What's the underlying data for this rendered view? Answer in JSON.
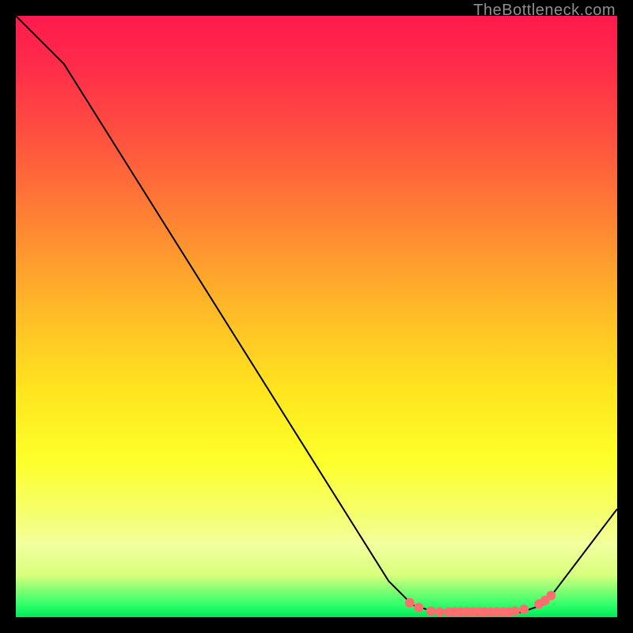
{
  "credit": "TheBottleneck.com",
  "colors": {
    "marker": "#ff6e6e",
    "curve": "#000000"
  },
  "chart_data": {
    "type": "line",
    "title": "",
    "xlabel": "",
    "ylabel": "",
    "xlim": [
      0,
      100
    ],
    "ylim": [
      0,
      100
    ],
    "curve": [
      {
        "x": 0,
        "y": 100
      },
      {
        "x": 8,
        "y": 92
      },
      {
        "x": 62,
        "y": 6
      },
      {
        "x": 66,
        "y": 2
      },
      {
        "x": 70,
        "y": 0.8
      },
      {
        "x": 84,
        "y": 0.8
      },
      {
        "x": 88,
        "y": 2.2
      },
      {
        "x": 100,
        "y": 18
      }
    ],
    "markers": [
      {
        "x": 65.5,
        "y": 2.4
      },
      {
        "x": 67.0,
        "y": 1.6
      },
      {
        "x": 69.0,
        "y": 1.0
      },
      {
        "x": 70.5,
        "y": 0.9
      },
      {
        "x": 72.0,
        "y": 0.9
      },
      {
        "x": 73.0,
        "y": 0.9
      },
      {
        "x": 74.0,
        "y": 0.9
      },
      {
        "x": 75.0,
        "y": 0.9
      },
      {
        "x": 76.0,
        "y": 0.9
      },
      {
        "x": 77.0,
        "y": 0.9
      },
      {
        "x": 78.0,
        "y": 0.9
      },
      {
        "x": 79.0,
        "y": 0.9
      },
      {
        "x": 80.0,
        "y": 0.9
      },
      {
        "x": 81.0,
        "y": 0.9
      },
      {
        "x": 82.0,
        "y": 0.9
      },
      {
        "x": 83.0,
        "y": 1.0
      },
      {
        "x": 84.5,
        "y": 1.3
      },
      {
        "x": 87.0,
        "y": 2.2
      },
      {
        "x": 88.0,
        "y": 2.8
      },
      {
        "x": 89.0,
        "y": 3.6
      }
    ]
  }
}
